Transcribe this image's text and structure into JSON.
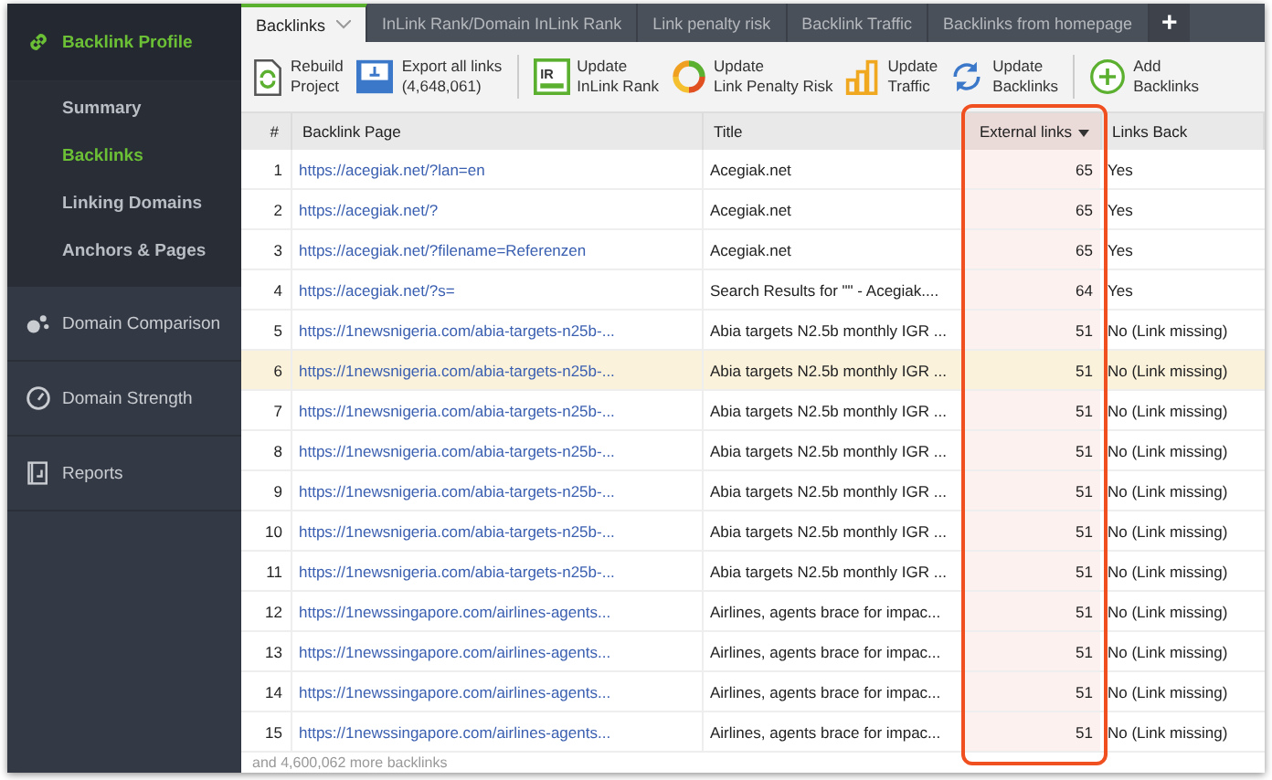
{
  "sidebar": {
    "sections": [
      {
        "label": "Backlink Profile",
        "selected": true,
        "items": [
          {
            "label": "Summary",
            "selected": false
          },
          {
            "label": "Backlinks",
            "selected": true
          },
          {
            "label": "Linking Domains",
            "selected": false
          },
          {
            "label": "Anchors & Pages",
            "selected": false
          }
        ]
      },
      {
        "label": "Domain Comparison",
        "selected": false
      },
      {
        "label": "Domain Strength",
        "selected": false
      },
      {
        "label": "Reports",
        "selected": false
      }
    ]
  },
  "tabs": [
    {
      "label": "Backlinks",
      "selected": true,
      "dropdown": true
    },
    {
      "label": "InLink Rank/Domain InLink Rank",
      "selected": false,
      "dropdown": false
    },
    {
      "label": "Link penalty risk",
      "selected": false,
      "dropdown": false
    },
    {
      "label": "Backlink Traffic",
      "selected": false,
      "dropdown": false
    },
    {
      "label": "Backlinks from homepage",
      "selected": false,
      "dropdown": false
    }
  ],
  "add_tab": "+",
  "toolbar": [
    {
      "kind": "rebuild",
      "line1": "Rebuild",
      "line2": "Project"
    },
    {
      "kind": "export",
      "line1": "Export all links",
      "line2": "(4,648,061)"
    },
    {
      "kind": "separator"
    },
    {
      "kind": "inlink",
      "icon_text": "IR",
      "line1": "Update",
      "line2": "InLink Rank"
    },
    {
      "kind": "penalty",
      "line1": "Update",
      "line2": "Link Penalty Risk"
    },
    {
      "kind": "traffic",
      "line1": "Update",
      "line2": "Traffic"
    },
    {
      "kind": "refresh",
      "line1": "Update",
      "line2": "Backlinks"
    },
    {
      "kind": "separator"
    },
    {
      "kind": "add",
      "line1": "Add",
      "line2": "Backlinks"
    }
  ],
  "table": {
    "columns": [
      {
        "label": "#",
        "sorted": false
      },
      {
        "label": "Backlink Page",
        "sorted": false
      },
      {
        "label": "Title",
        "sorted": false
      },
      {
        "label": "External links",
        "sorted": true
      },
      {
        "label": "Links Back",
        "sorted": false
      }
    ],
    "rows": [
      {
        "num": "1",
        "url": "https://acegiak.net/?lan=en",
        "title": "Acegiak.net",
        "external": "65",
        "back": "Yes",
        "selected": false
      },
      {
        "num": "2",
        "url": "https://acegiak.net/?",
        "title": "Acegiak.net",
        "external": "65",
        "back": "Yes",
        "selected": false
      },
      {
        "num": "3",
        "url": "https://acegiak.net/?filename=Referenzen",
        "title": "Acegiak.net",
        "external": "65",
        "back": "Yes",
        "selected": false
      },
      {
        "num": "4",
        "url": "https://acegiak.net/?s=",
        "title": "Search Results for \"\" - Acegiak....",
        "external": "64",
        "back": "Yes",
        "selected": false
      },
      {
        "num": "5",
        "url": "https://1newsnigeria.com/abia-targets-n25b-...",
        "title": "Abia targets N2.5b monthly IGR ...",
        "external": "51",
        "back": "No (Link missing)",
        "selected": false
      },
      {
        "num": "6",
        "url": "https://1newsnigeria.com/abia-targets-n25b-...",
        "title": "Abia targets N2.5b monthly IGR ...",
        "external": "51",
        "back": "No (Link missing)",
        "selected": true
      },
      {
        "num": "7",
        "url": "https://1newsnigeria.com/abia-targets-n25b-...",
        "title": "Abia targets N2.5b monthly IGR ...",
        "external": "51",
        "back": "No (Link missing)",
        "selected": false
      },
      {
        "num": "8",
        "url": "https://1newsnigeria.com/abia-targets-n25b-...",
        "title": "Abia targets N2.5b monthly IGR ...",
        "external": "51",
        "back": "No (Link missing)",
        "selected": false
      },
      {
        "num": "9",
        "url": "https://1newsnigeria.com/abia-targets-n25b-...",
        "title": "Abia targets N2.5b monthly IGR ...",
        "external": "51",
        "back": "No (Link missing)",
        "selected": false
      },
      {
        "num": "10",
        "url": "https://1newsnigeria.com/abia-targets-n25b-...",
        "title": "Abia targets N2.5b monthly IGR ...",
        "external": "51",
        "back": "No (Link missing)",
        "selected": false
      },
      {
        "num": "11",
        "url": "https://1newsnigeria.com/abia-targets-n25b-...",
        "title": "Abia targets N2.5b monthly IGR ...",
        "external": "51",
        "back": "No (Link missing)",
        "selected": false
      },
      {
        "num": "12",
        "url": "https://1newssingapore.com/airlines-agents...",
        "title": "Airlines, agents brace for impac...",
        "external": "51",
        "back": "No (Link missing)",
        "selected": false
      },
      {
        "num": "13",
        "url": "https://1newssingapore.com/airlines-agents...",
        "title": "Airlines, agents brace for impac...",
        "external": "51",
        "back": "No (Link missing)",
        "selected": false
      },
      {
        "num": "14",
        "url": "https://1newssingapore.com/airlines-agents...",
        "title": "Airlines, agents brace for impac...",
        "external": "51",
        "back": "No (Link missing)",
        "selected": false
      },
      {
        "num": "15",
        "url": "https://1newssingapore.com/airlines-agents...",
        "title": "Airlines, agents brace for impac...",
        "external": "51",
        "back": "No (Link missing)",
        "selected": false
      }
    ],
    "footer": "and 4,600,062 more backlinks"
  }
}
